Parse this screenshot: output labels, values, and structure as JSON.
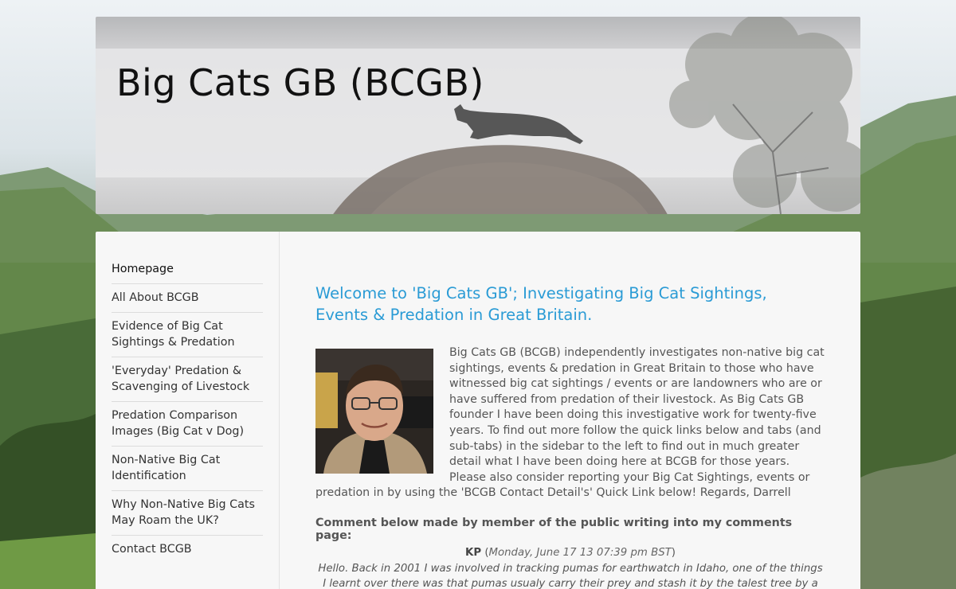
{
  "site": {
    "title": "Big Cats GB (BCGB)"
  },
  "sidebar": {
    "items": [
      {
        "label": "Homepage"
      },
      {
        "label": "All About BCGB"
      },
      {
        "label": "Evidence of Big Cat Sightings & Predation"
      },
      {
        "label": "'Everyday' Predation & Scavenging of Livestock"
      },
      {
        "label": "Predation Comparison Images (Big Cat v Dog)"
      },
      {
        "label": "Non-Native Big Cat Identification"
      },
      {
        "label": "Why Non-Native Big Cats May Roam the UK?"
      },
      {
        "label": "Contact BCGB"
      }
    ]
  },
  "main": {
    "heading": "Welcome to 'Big Cats GB'; Investigating Big Cat Sightings, Events & Predation in Great Britain.",
    "intro": "Big Cats GB (BCGB) independently investigates non-native big cat sightings, events & predation in Great Britain to those who have witnessed big cat sightings / events or are landowners who are or have suffered from predation of their livestock.  As Big Cats GB founder I have been doing this investigative work for twenty-five years. To find out more follow the quick links below and tabs (and sub-tabs) in the sidebar to the left to find out in much greater detail what I have been doing here at BCGB for those years. Please also consider reporting your Big Cat Sightings, events or predation in by using the 'BCGB Contact Detail's' Quick Link below! Regards, Darrell",
    "comment_heading": "Comment below made by member of the public writing into my comments page:",
    "comment_author": "KP",
    "comment_date": "Monday, June 17 13 07:39 pm BST",
    "comment_body": "Hello. Back in 2001 I was involved in tracking pumas for earthwatch in Idaho, one of the things I learnt over there was that pumas usualy carry their prey and stash it by the talest tree by a"
  },
  "colors": {
    "heading": "#2a9bd5",
    "body_text": "#555555",
    "panel": "#f7f7f7"
  }
}
